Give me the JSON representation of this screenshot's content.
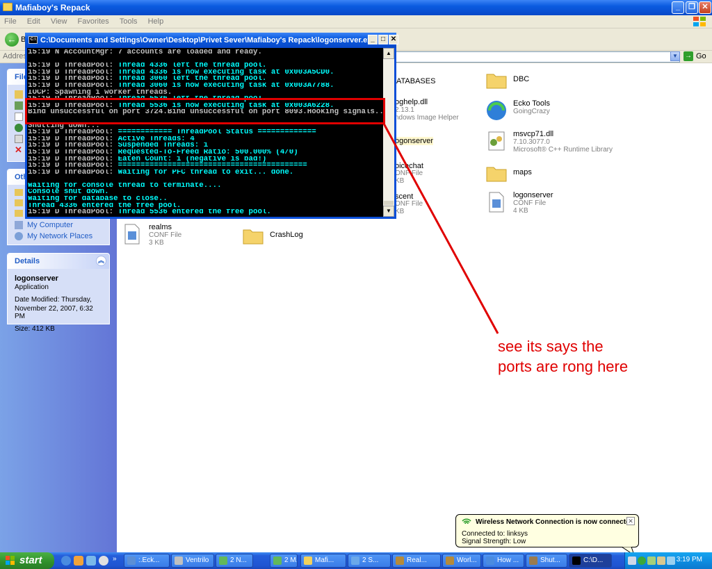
{
  "explorer": {
    "title": "Mafiaboy's Repack",
    "menu": [
      "File",
      "Edit",
      "View",
      "Favorites",
      "Tools",
      "Help"
    ],
    "back_label": "B",
    "address_label": "Address",
    "go_label": "Go"
  },
  "left_pane": {
    "tasks_header": "File",
    "other_header": "Oth",
    "other_items": [
      "My Computer",
      "My Network Places"
    ],
    "details": {
      "header": "Details",
      "name": "logonserver",
      "type": "Application",
      "modified_1": "Date Modified: Thursday,",
      "modified_2": "November 22, 2007, 6:32 PM",
      "size": "Size: 412 KB"
    }
  },
  "files": [
    {
      "name": "ATABASES",
      "kind": "folder",
      "line1": "",
      "line2": ""
    },
    {
      "name": "DBC",
      "kind": "folder",
      "line1": "",
      "line2": ""
    },
    {
      "name": "oghelp.dll",
      "kind": "dll",
      "line1": "2.13.1",
      "line2": "ndows Image Helper"
    },
    {
      "name": "Ecko Tools",
      "kind": "app",
      "line1": "GoingCrazy",
      "line2": ""
    },
    {
      "name": "msvcp71.dll",
      "kind": "dll",
      "line1": "7.10.3077.0",
      "line2": "Microsoft® C++ Runtime Library"
    },
    {
      "name": "ogonserver",
      "kind": "app",
      "line1": "",
      "line2": ""
    },
    {
      "name": "oicechat",
      "kind": "conf",
      "line1": "ONF File",
      "line2": "KB"
    },
    {
      "name": "maps",
      "kind": "folder",
      "line1": "",
      "line2": ""
    },
    {
      "name": "logonserver",
      "kind": "conf",
      "line1": "CONF File",
      "line2": "4 KB"
    },
    {
      "name": "scent",
      "kind": "conf",
      "line1": "ONF File",
      "line2": "KB"
    },
    {
      "name": "realms",
      "kind": "conf",
      "line1": "CONF File",
      "line2": "3 KB"
    },
    {
      "name": "CrashLog",
      "kind": "folder",
      "line1": "",
      "line2": ""
    }
  ],
  "console": {
    "title": "C:\\Documents and Settings\\Owner\\Desktop\\Privet Sever\\Mafiaboy's Repack\\logonserver.exe",
    "lines": [
      {
        "p": "15:19 N AccountMgr: ",
        "t": "7 accounts are loaded and ready.",
        "c": "gray"
      },
      {
        "p": "",
        "t": "",
        "c": "gray"
      },
      {
        "p": "15:19 D ThreadPool: ",
        "t": "Thread 4336 left the thread pool.",
        "c": "cyan"
      },
      {
        "p": "15:19 D ThreadPool: ",
        "t": "Thread 4336 is now executing task at 0x003A5CD0.",
        "c": "cyan"
      },
      {
        "p": "15:19 D ThreadPool: ",
        "t": "Thread 3060 left the thread pool.",
        "c": "cyan"
      },
      {
        "p": "15:19 D ThreadPool: ",
        "t": "Thread 3060 is now executing task at 0x003A7788.",
        "c": "cyan"
      },
      {
        "p": "IOCP: Spawning 1 worker threads.",
        "t": "",
        "c": "gray"
      },
      {
        "p": "15:19 D ThreadPool: ",
        "t": "Thread 5536 left the thread pool.",
        "c": "cyan"
      },
      {
        "p": "15:19 D ThreadPool: ",
        "t": "Thread 5536 is now executing task at 0x003A6228.",
        "c": "cyan"
      },
      {
        "p": "Bind unsuccessful on port 3724.Bind unsuccessful on port 8093.Hooking signals...",
        "t": "",
        "c": "gray"
      },
      {
        "p": "",
        "t": "",
        "c": "gray"
      },
      {
        "p": "Shutting down...",
        "t": "",
        "c": "gray"
      },
      {
        "p": "15:19 D ThreadPool: ",
        "t": "============ ThreadPool Status =============",
        "c": "cyan"
      },
      {
        "p": "15:19 D ThreadPool: ",
        "t": "Active Threads: 4",
        "c": "cyan"
      },
      {
        "p": "15:19 D ThreadPool: ",
        "t": "Suspended Threads: 1",
        "c": "cyan"
      },
      {
        "p": "15:19 D ThreadPool: ",
        "t": "Requested-To-Freed Ratio: 500.000% (4/0)",
        "c": "cyan"
      },
      {
        "p": "15:19 D ThreadPool: ",
        "t": "Eaten Count: 1 (negative is bad!)",
        "c": "cyan"
      },
      {
        "p": "15:19 D ThreadPool: ",
        "t": "==========================================",
        "c": "cyan"
      },
      {
        "p": "15:19 D ThreadPool: ",
        "t": "Waiting for PFC thread to exit... done.",
        "c": "cyan"
      },
      {
        "p": "",
        "t": "",
        "c": "gray"
      },
      {
        "p": "Waiting for console thread to terminate....",
        "t": "",
        "c": "cyan"
      },
      {
        "p": "Console shut down.",
        "t": "",
        "c": "cyan"
      },
      {
        "p": "Waiting for database to close..",
        "t": "",
        "c": "cyan"
      },
      {
        "p": "Thread 4336 entered the free pool.",
        "t": "",
        "c": "cyan"
      },
      {
        "p": "15:19 D ThreadPool: ",
        "t": "Thread 5536 entered the free pool.",
        "c": "cyan"
      }
    ]
  },
  "annotation": {
    "line1": "see its says the",
    "line2": "ports are rong here",
    "color": "#e00000"
  },
  "balloon": {
    "title": "Wireless Network Connection is now connected",
    "line1": "Connected to: linksys",
    "line2": "Signal Strength: Low"
  },
  "taskbar": {
    "start": "start",
    "tasks": [
      {
        "label": ":.Eck...",
        "icon": "#5b8fd6",
        "active": false
      },
      {
        "label": "Ventrilo",
        "icon": "#c0c0c0",
        "active": false
      },
      {
        "label": "2 N...",
        "icon": "#62b85a",
        "active": false
      },
      {
        "label": "2 M...",
        "icon": "#62b85a",
        "active": false
      },
      {
        "label": "Mafi...",
        "icon": "#f2d15c",
        "active": false
      },
      {
        "label": "2 S...",
        "icon": "#6aa8ea",
        "active": false
      },
      {
        "label": "Real...",
        "icon": "#b58a3a",
        "active": false
      },
      {
        "label": "Worl...",
        "icon": "#b58a3a",
        "active": false
      },
      {
        "label": "How ...",
        "icon": "#4a8be0",
        "active": false
      },
      {
        "label": "Shut...",
        "icon": "#9a7b4f",
        "active": false
      },
      {
        "label": "C:\\D...",
        "icon": "#000000",
        "active": true
      }
    ],
    "clock": "3:19 PM"
  }
}
